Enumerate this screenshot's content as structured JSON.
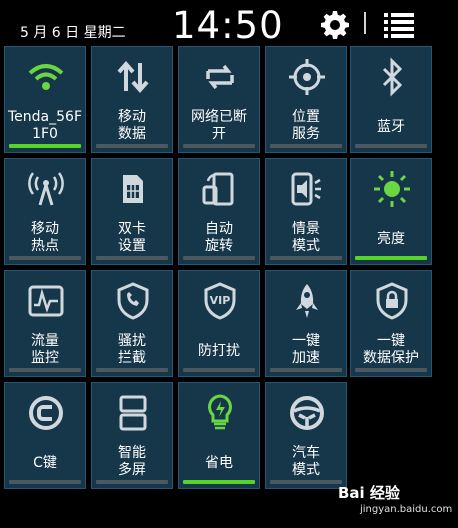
{
  "status_bar": {
    "date": "5 月 6 日  星期二",
    "time": "14:50",
    "settings_icon": "gear-icon",
    "list_icon": "list-icon"
  },
  "tiles": [
    {
      "label": "Tenda_56F\n1F0",
      "icon": "wifi-icon",
      "active": true,
      "icon_color": "#6ad641"
    },
    {
      "label": "移动\n数据",
      "icon": "mobile-data-icon",
      "active": false,
      "icon_color": "#d0d8de"
    },
    {
      "label": "网络已断\n开",
      "icon": "sync-icon",
      "active": false,
      "icon_color": "#d0d8de"
    },
    {
      "label": "位置\n服务",
      "icon": "location-icon",
      "active": false,
      "icon_color": "#d0d8de"
    },
    {
      "label": "蓝牙",
      "icon": "bluetooth-icon",
      "active": false,
      "icon_color": "#d0d8de"
    },
    {
      "label": "移动\n热点",
      "icon": "hotspot-icon",
      "active": false,
      "icon_color": "#d0d8de"
    },
    {
      "label": "双卡\n设置",
      "icon": "dual-sim-icon",
      "active": false,
      "icon_color": "#d0d8de"
    },
    {
      "label": "自动\n旋转",
      "icon": "auto-rotate-icon",
      "active": false,
      "icon_color": "#d0d8de"
    },
    {
      "label": "情景\n模式",
      "icon": "sound-mode-icon",
      "active": false,
      "icon_color": "#d0d8de"
    },
    {
      "label": "亮度",
      "icon": "brightness-icon",
      "active": true,
      "icon_color": "#6ad641"
    },
    {
      "label": "流量\n监控",
      "icon": "traffic-monitor-icon",
      "active": false,
      "icon_color": "#d0d8de"
    },
    {
      "label": "骚扰\n拦截",
      "icon": "call-block-icon",
      "active": false,
      "icon_color": "#d0d8de"
    },
    {
      "label": "防打扰",
      "icon": "vip-icon",
      "active": false,
      "icon_color": "#d0d8de"
    },
    {
      "label": "一键\n加速",
      "icon": "rocket-icon",
      "active": false,
      "icon_color": "#d0d8de"
    },
    {
      "label": "一键\n数据保护",
      "icon": "data-protect-icon",
      "active": false,
      "icon_color": "#d0d8de"
    },
    {
      "label": "C键",
      "icon": "c-key-icon",
      "active": false,
      "icon_color": "#d0d8de"
    },
    {
      "label": "智能\n多屏",
      "icon": "multi-screen-icon",
      "active": false,
      "icon_color": "#d0d8de"
    },
    {
      "label": "省电",
      "icon": "power-saving-icon",
      "active": true,
      "icon_color": "#6ad641"
    },
    {
      "label": "汽车\n模式",
      "icon": "car-mode-icon",
      "active": false,
      "icon_color": "#d0d8de"
    }
  ],
  "watermark": {
    "logo": "Bai 经验",
    "sub": "jingyan.baidu.com"
  }
}
